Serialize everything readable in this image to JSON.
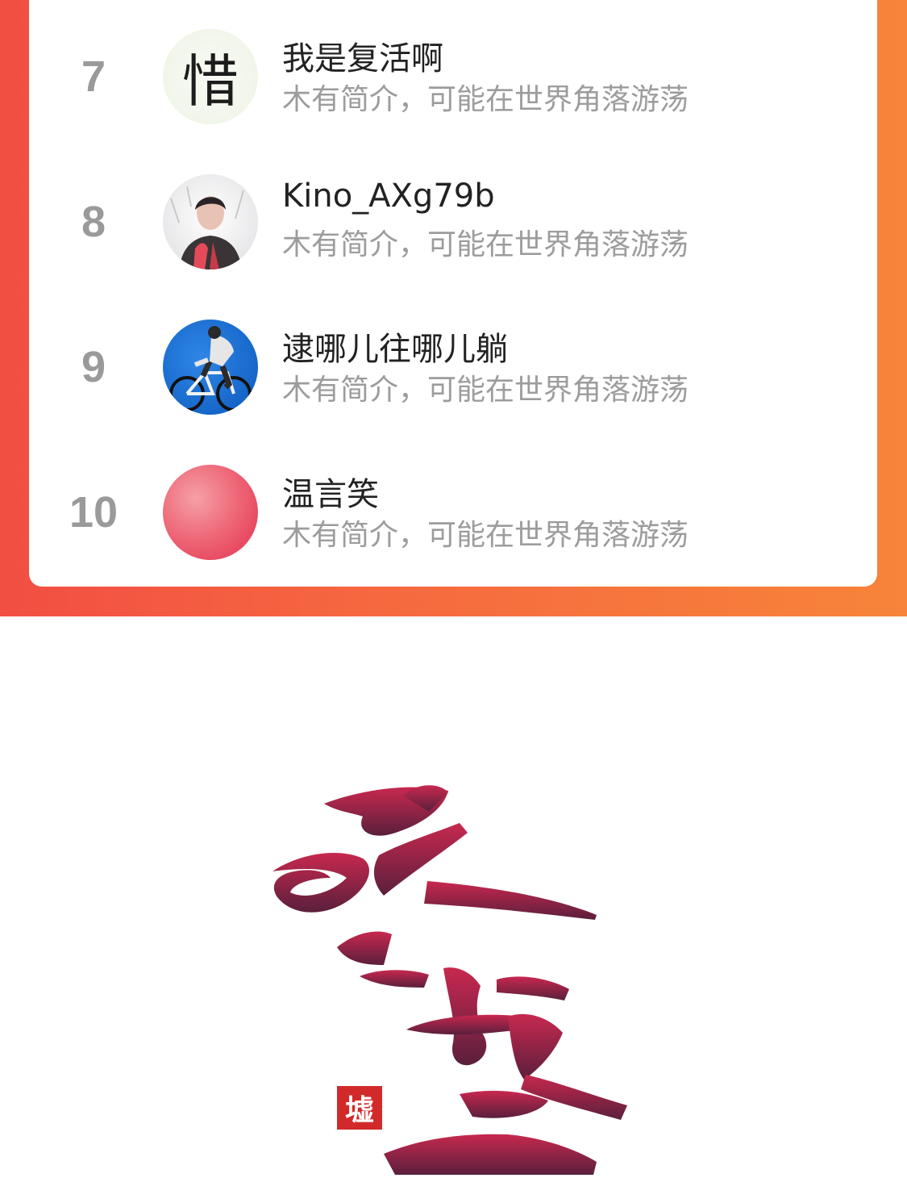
{
  "ranking": {
    "rows": [
      {
        "rank": "7",
        "name": "我是复活啊",
        "bio": "木有简介，可能在世界角落游荡",
        "avatar_text": "惜"
      },
      {
        "rank": "8",
        "name": "Kino_AXg79b",
        "bio": "木有简介，可能在世界角落游荡"
      },
      {
        "rank": "9",
        "name": "逮哪儿往哪儿躺",
        "bio": "木有简介，可能在世界角落游荡"
      },
      {
        "rank": "10",
        "name": "温言笑",
        "bio": "木有简介，可能在世界角落游荡"
      }
    ]
  },
  "logo": {
    "text": "圣墟",
    "seal_text": "墟"
  },
  "colors": {
    "banner_left": "#f24e43",
    "banner_right": "#f7843a",
    "logo_top": "#c8284f",
    "logo_bottom": "#5a1f3c"
  }
}
